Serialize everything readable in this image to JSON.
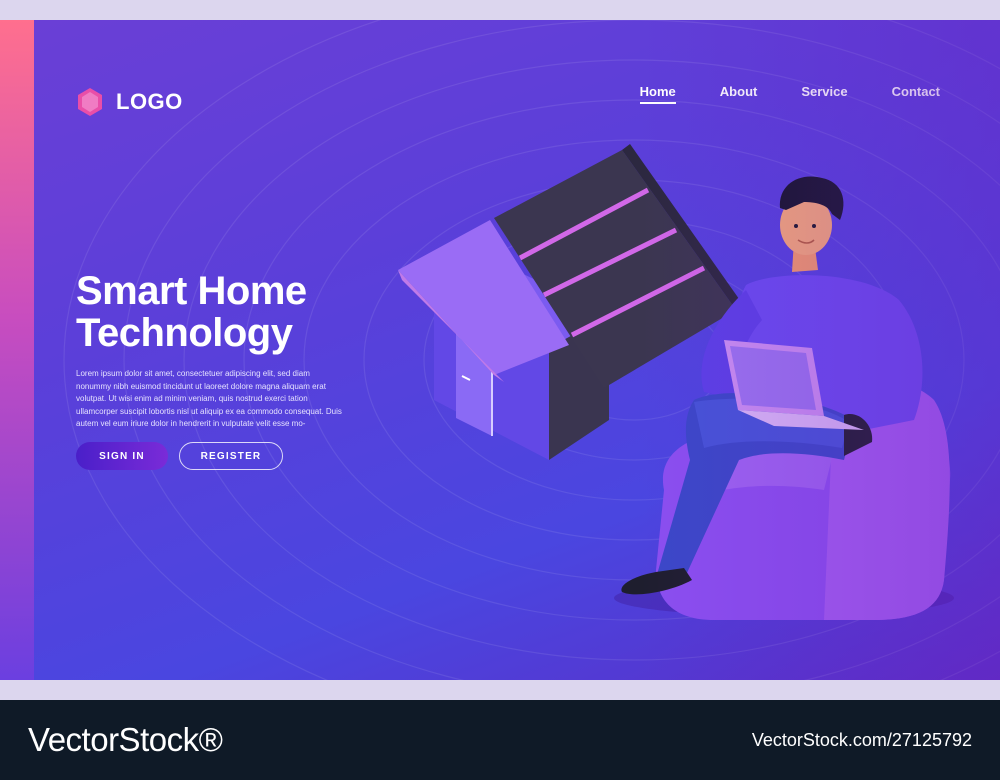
{
  "logo": {
    "text": "LOGO",
    "icon": "hexagon-logo-icon"
  },
  "nav": {
    "items": [
      {
        "label": "Home",
        "active": true
      },
      {
        "label": "About",
        "active": false
      },
      {
        "label": "Service",
        "active": false
      },
      {
        "label": "Contact",
        "active": false
      }
    ]
  },
  "hero": {
    "title_line1": "Smart Home",
    "title_line2": "Technology",
    "body": "Lorem ipsum dolor sit amet, consectetuer adipiscing elit, sed diam nonummy nibh euismod tincidunt ut laoreet dolore magna aliquam erat volutpat. Ut wisi enim ad minim veniam, quis nostrud exerci tation ullamcorper suscipit lobortis nisl ut aliquip ex ea commodo consequat. Duis autem vel eum iriure dolor in hendrerit in vulputate velit esse mo-",
    "sign_in_label": "SIGN IN",
    "register_label": "REGISTER"
  },
  "watermark": {
    "brand": "VectorStock®",
    "id": "VectorStock.com/27125792"
  },
  "colors": {
    "accent_strip": "#ff6f8e",
    "hero_bg": "#5b3fd9",
    "footer_bg": "#0f1a27",
    "button_primary": "#5a23cf"
  }
}
